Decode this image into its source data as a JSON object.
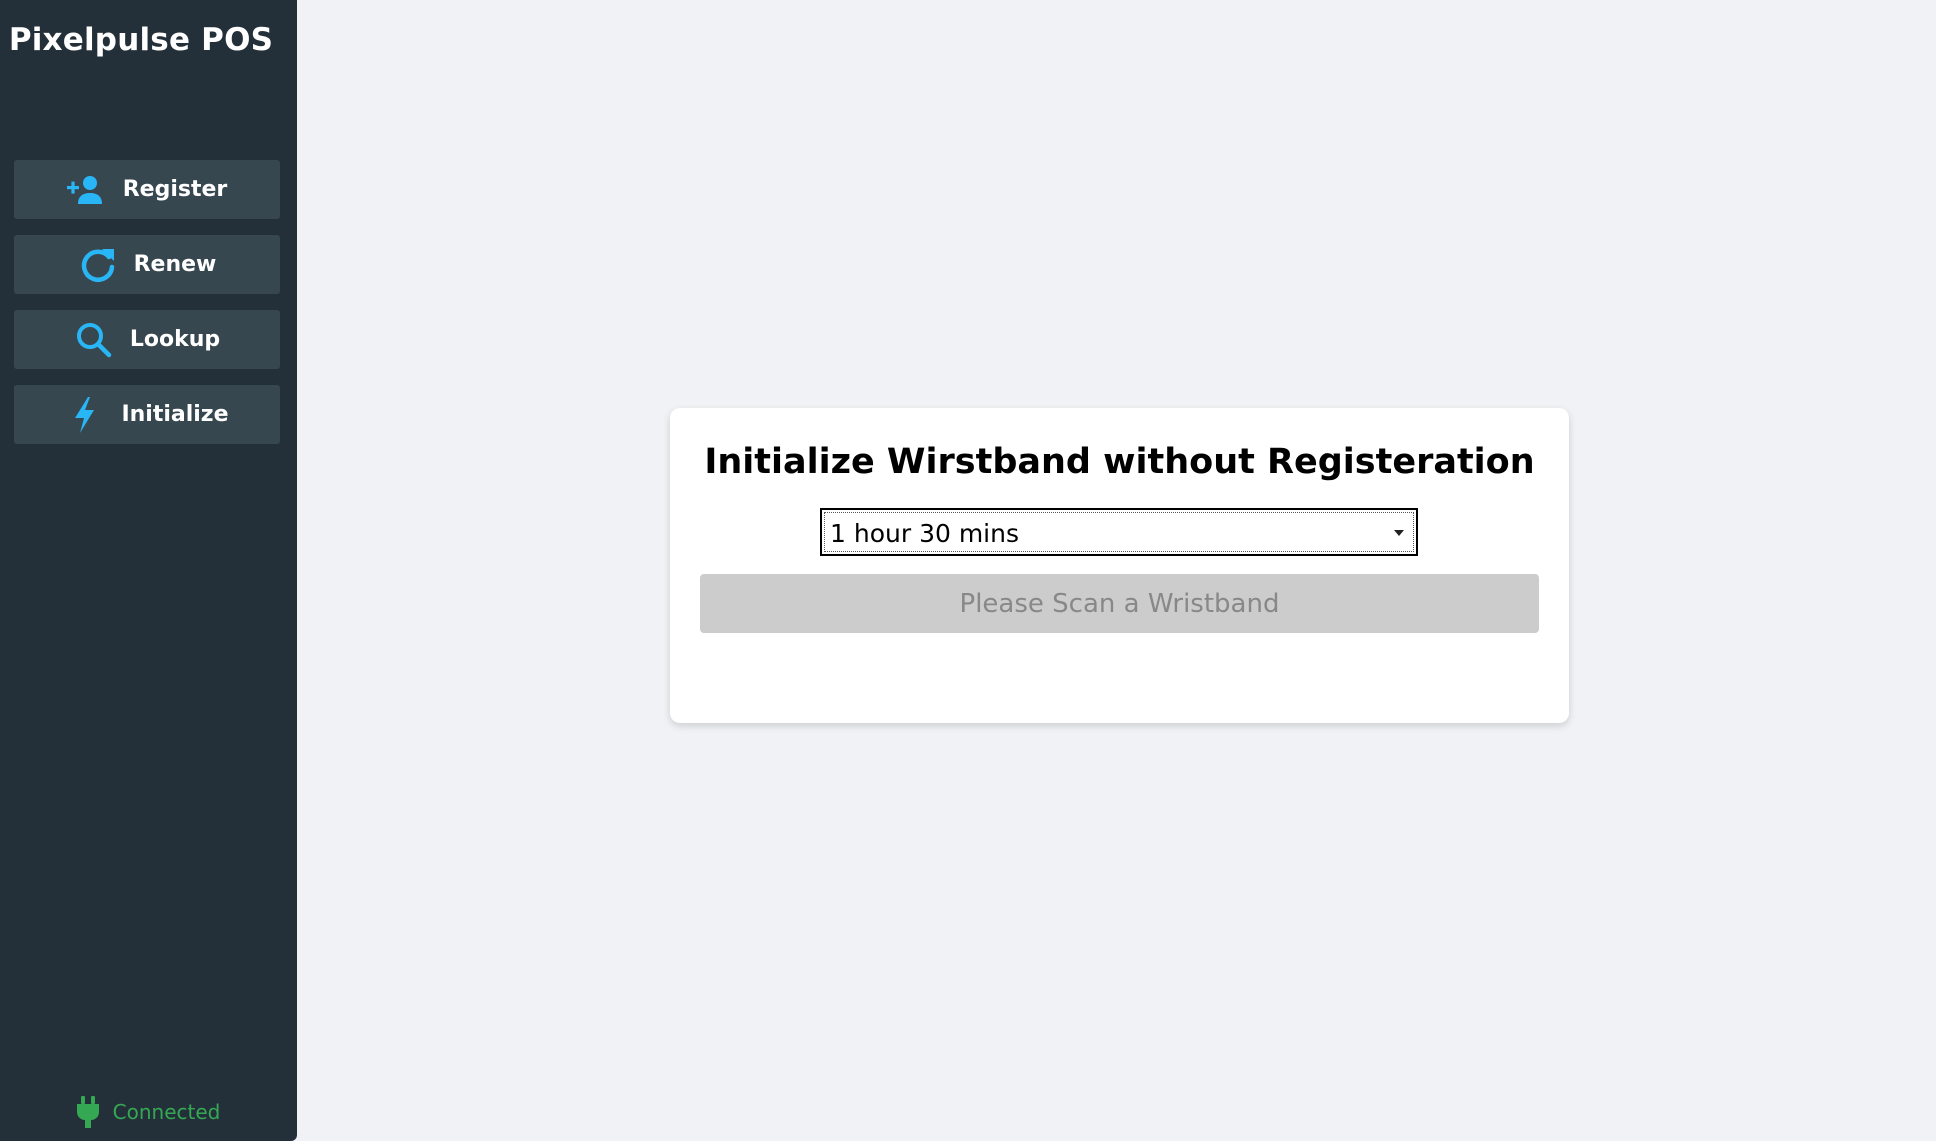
{
  "app": {
    "title": "Pixelpulse POS"
  },
  "sidebar": {
    "items": [
      {
        "label": "Register",
        "icon": "add-user-icon"
      },
      {
        "label": "Renew",
        "icon": "refresh-icon"
      },
      {
        "label": "Lookup",
        "icon": "search-icon"
      },
      {
        "label": "Initialize",
        "icon": "bolt-icon"
      }
    ],
    "status": {
      "label": "Connected",
      "icon": "plug-icon",
      "color": "#34a853"
    }
  },
  "main": {
    "card": {
      "title": "Initialize Wirstband without Registeration",
      "duration_select": {
        "selected": "1 hour 30 mins"
      },
      "scan_button_label": "Please Scan a Wristband"
    }
  },
  "colors": {
    "accent": "#29b6f6",
    "sidebar_bg": "#243039",
    "nav_item_bg": "#37474f",
    "page_bg": "#f0f2f5",
    "disabled_button_bg": "#cccccc"
  }
}
